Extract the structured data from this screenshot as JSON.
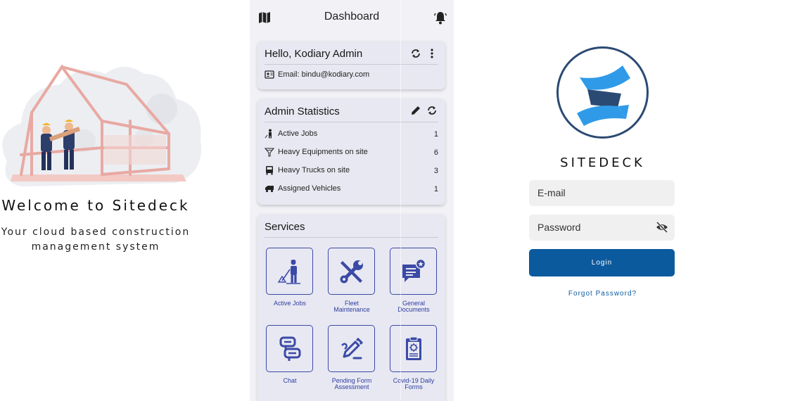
{
  "welcome": {
    "title": "Welcome to Sitedeck",
    "subtitle_line1": "Your cloud based construction",
    "subtitle_line2": "management system",
    "illustration": "construction-workers-illustration"
  },
  "dashboard": {
    "appbar": {
      "title": "Dashboard",
      "left_icon": "map-icon",
      "right_icon": "bell-icon"
    },
    "hello_card": {
      "greeting": "Hello, Kodiary Admin",
      "email": "Email: bindu@kodiary.com",
      "icons": [
        "refresh-icon",
        "more-vert-icon",
        "contact-card-icon"
      ]
    },
    "stats_card": {
      "title": "Admin Statistics",
      "icons": [
        "edit-icon",
        "refresh-icon"
      ],
      "rows": [
        {
          "label": "Active Jobs",
          "value": "1",
          "icon": "worker-icon"
        },
        {
          "label": "Heavy Equipments on site",
          "value": "6",
          "icon": "funnel-icon"
        },
        {
          "label": "Heavy Trucks on site",
          "value": "3",
          "icon": "truck-front-icon"
        },
        {
          "label": "Assigned Vehicles",
          "value": "1",
          "icon": "truck-side-icon"
        }
      ]
    },
    "services_card": {
      "title": "Services",
      "items": [
        {
          "label_line1": "Active Jobs",
          "label_line2": "",
          "icon": "worker-icon"
        },
        {
          "label_line1": "Fleet",
          "label_line2": "Maintenance",
          "icon": "tools-icon"
        },
        {
          "label_line1": "General",
          "label_line2": "Documents",
          "icon": "document-badge-icon"
        },
        {
          "label_line1": "Chat",
          "label_line2": "",
          "icon": "chat-icon"
        },
        {
          "label_line1": "Pending Form",
          "label_line2": "Assessment",
          "icon": "pen-icon"
        },
        {
          "label_line1": "Covid-19 Daily",
          "label_line2": "Forms",
          "icon": "clipboard-virus-icon"
        }
      ]
    }
  },
  "login": {
    "brand": "SITEDECK",
    "email_placeholder": "E-mail",
    "password_placeholder": "Password",
    "login_label": "Login",
    "forgot_label": "Forgot Password?",
    "colors": {
      "primary": "#0c5a9e",
      "logo_light": "#2f9be8",
      "logo_dark": "#2b4a73"
    }
  }
}
